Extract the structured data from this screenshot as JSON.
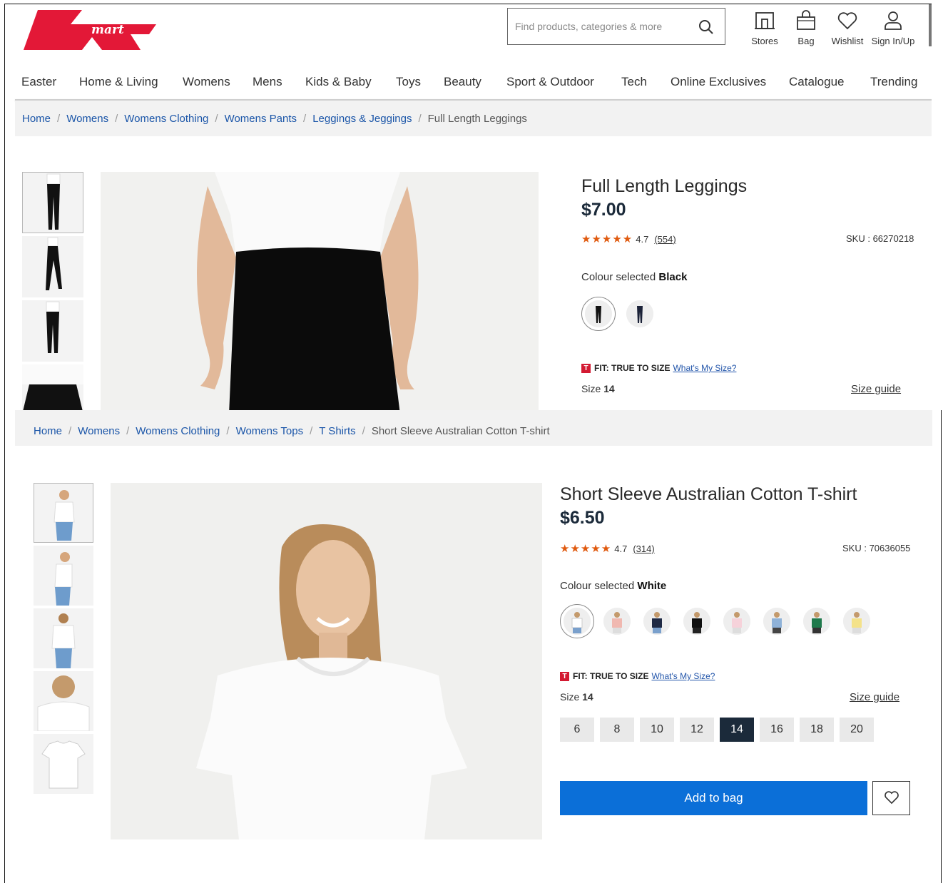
{
  "header": {
    "search_placeholder": "Find products, categories & more",
    "stores_label": "Stores",
    "bag_label": "Bag",
    "wishlist_label": "Wishlist",
    "signin_label": "Sign In/Up",
    "logo_text": "mart",
    "brand_color": "#e31837"
  },
  "nav": [
    "Easter",
    "Home & Living",
    "Womens",
    "Mens",
    "Kids & Baby",
    "Toys",
    "Beauty",
    "Sport & Outdoor",
    "Tech",
    "Online Exclusives",
    "Catalogue",
    "Trending"
  ],
  "product1": {
    "breadcrumb": [
      "Home",
      "Womens",
      "Womens Clothing",
      "Womens Pants",
      "Leggings & Jeggings"
    ],
    "breadcrumb_current": "Full Length Leggings",
    "title": "Full Length Leggings",
    "price": "$7.00",
    "rating": "4.7",
    "review_count": "(554)",
    "sku": "SKU : 66270218",
    "colour_prefix": "Colour selected",
    "colour": "Black",
    "fit_text": "FIT: TRUE TO SIZE",
    "fit_link": "What's My Size?",
    "size_prefix": "Size",
    "size": "14",
    "size_guide": "Size guide",
    "fit_badge": "T"
  },
  "product2": {
    "breadcrumb": [
      "Home",
      "Womens",
      "Womens Clothing",
      "Womens Tops",
      "T Shirts"
    ],
    "breadcrumb_current": "Short Sleeve Australian Cotton T-shirt",
    "title": "Short Sleeve Australian Cotton T-shirt",
    "price": "$6.50",
    "rating": "4.7",
    "review_count": "(314)",
    "sku": "SKU : 70636055",
    "colour_prefix": "Colour selected",
    "colour": "White",
    "fit_text": "FIT: TRUE TO SIZE",
    "fit_link": "What's My Size?",
    "size_prefix": "Size",
    "size": "14",
    "size_guide": "Size guide",
    "sizes": [
      "6",
      "8",
      "10",
      "12",
      "14",
      "16",
      "18",
      "20"
    ],
    "selected_size": "14",
    "add_to_bag": "Add to bag",
    "fit_badge": "T"
  },
  "colors": {
    "accent_blue": "#0b6fd8",
    "navy": "#1b2a3a",
    "star_orange": "#e05a0f",
    "link_blue": "#1a55a8"
  }
}
